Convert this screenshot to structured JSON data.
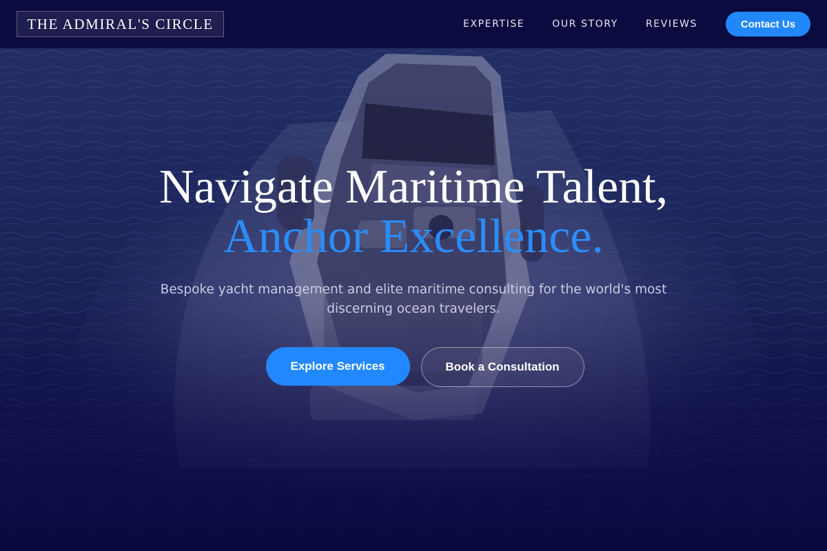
{
  "brand": {
    "name": "THE ADMIRAL'S CIRCLE"
  },
  "nav": {
    "links": [
      "EXPERTISE",
      "OUR STORY",
      "REVIEWS"
    ],
    "contact_label": "Contact Us"
  },
  "hero": {
    "headline_line1": "Navigate Maritime Talent,",
    "headline_line2": "Anchor Excellence.",
    "subtitle": "Bespoke yacht management and elite maritime consulting for the world's most discerning ocean travelers.",
    "primary_cta": "Explore Services",
    "secondary_cta": "Book a Consultation",
    "background_image": "aerial-speedboat-ocean-wake"
  },
  "colors": {
    "accent": "#2288ff",
    "headline_accent": "#2b8cf7",
    "nav_background": "#0a093e",
    "overlay": "#0b0a3a"
  }
}
